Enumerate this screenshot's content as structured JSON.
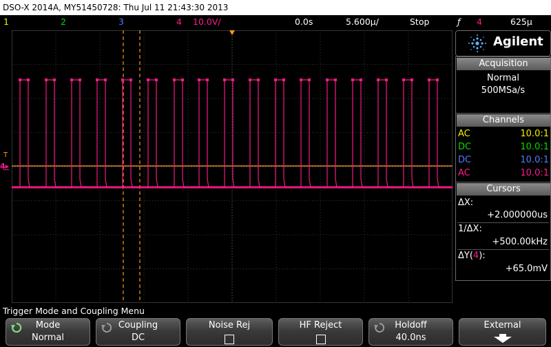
{
  "title": "DSO-X 2014A, MY51450728: Thu Jul 11 21:43:30 2013",
  "status": {
    "ch1": "1",
    "ch2": "2",
    "ch3": "3",
    "ch4": "4",
    "ch4_scale": "10.0V/",
    "time_offset": "0.0s",
    "time_scale": "5.600µ/",
    "run_state": "Stop",
    "trigger_symbol": "ƒ",
    "trigger_channel": "4",
    "trigger_level": "625µ"
  },
  "colors": {
    "ch1": "#f2f200",
    "ch2": "#00e000",
    "ch3": "#5a78ff",
    "ch4": "#ff1a8c",
    "cursor": "#ff9a1a"
  },
  "brand": "Agilent",
  "acquisition": {
    "header": "Acquisition",
    "mode": "Normal",
    "rate": "500MSa/s"
  },
  "channels": {
    "header": "Channels",
    "rows": [
      {
        "coupling": "AC",
        "ratio": "10.0:1"
      },
      {
        "coupling": "DC",
        "ratio": "10.0:1"
      },
      {
        "coupling": "DC",
        "ratio": "10.0:1"
      },
      {
        "coupling": "AC",
        "ratio": "10.0:1"
      }
    ]
  },
  "cursors": {
    "header": "Cursors",
    "dx_label": "ΔX:",
    "dx_value": "+2.000000us",
    "inv_label": "1/ΔX:",
    "inv_value": "+500.00kHz",
    "dy_label_pre": "ΔY(",
    "dy_channel": "4",
    "dy_label_post": "):",
    "dy_value": "+65.0mV"
  },
  "markers": {
    "trigger_T": "T",
    "ground_4": "4"
  },
  "menu": {
    "title": "Trigger Mode and Coupling Menu",
    "softkeys": [
      {
        "label": "Mode",
        "value": "Normal",
        "icon": "rotate-icon"
      },
      {
        "label": "Coupling",
        "value": "DC",
        "icon": "rotate-icon"
      },
      {
        "label": "Noise Rej",
        "value": "",
        "icon": "checkbox"
      },
      {
        "label": "HF Reject",
        "value": "",
        "icon": "checkbox"
      },
      {
        "label": "Holdoff",
        "value": "40.0ns",
        "icon": "rotate-icon"
      },
      {
        "label": "External",
        "value": "",
        "icon": "arrow-down-icon"
      }
    ]
  }
}
